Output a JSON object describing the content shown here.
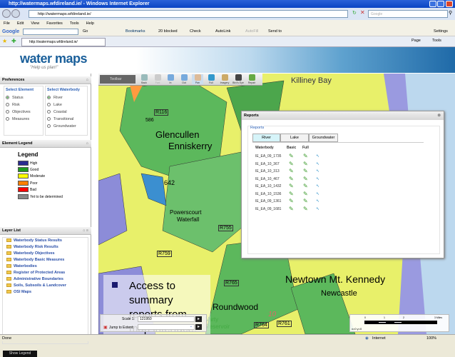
{
  "window": {
    "title": "http://watermaps.wfdireland.ie/ - Windows Internet Explorer",
    "url": "http://watermaps.wfdireland.ie/",
    "search_placeholder": "Google"
  },
  "menu": [
    "File",
    "Edit",
    "View",
    "Favorites",
    "Tools",
    "Help"
  ],
  "google_toolbar": {
    "brand": "Google",
    "go": "Go",
    "bookmarks": "Bookmarks",
    "blocked": "20 blocked",
    "check": "Check",
    "autolink": "AutoLink",
    "autofill": "AutoFill",
    "sendto": "Send to",
    "settings": "Settings"
  },
  "tab": {
    "label": "http://watermaps.wfdireland.ie/",
    "page": "Page",
    "tools": "Tools"
  },
  "site": {
    "logo": "water maps",
    "tagline": "\"Help us plan!\""
  },
  "preferences": {
    "title": "Preferences",
    "select_element": "Select Element",
    "elements": [
      "Status",
      "Risk",
      "Objectives",
      "Measures"
    ],
    "select_waterbody": "Select Waterbody",
    "waterbodies": [
      "River",
      "Lake",
      "Coastal",
      "Transitional",
      "Groundwater"
    ]
  },
  "legend": {
    "panel_title": "Element Legend",
    "title": "Legend",
    "items": [
      {
        "label": "High",
        "color": "#2b2b8f"
      },
      {
        "label": "Good",
        "color": "#1f9a1f"
      },
      {
        "label": "Moderate",
        "color": "#ffff00"
      },
      {
        "label": "Poor",
        "color": "#ff7f00"
      },
      {
        "label": "Bad",
        "color": "#ff0000"
      },
      {
        "label": "Yet to be determined",
        "color": "#888888"
      }
    ]
  },
  "layers": {
    "title": "Layer List",
    "items": [
      "Waterbody Status Results",
      "Waterbody Risk Results",
      "Waterbody Objectives",
      "Waterbody Basic Measures",
      "Waterbodies",
      "Register of Protected Areas",
      "Administrative Boundaries",
      "Soils, Subsoils & Landcover",
      "OSI Maps"
    ],
    "show_legend": "Show Legend"
  },
  "map_toolbar": {
    "title": "Toolbar",
    "tools": [
      "Back",
      "Fwd",
      "In",
      "Out",
      "Pan",
      "Full",
      "Imagery",
      "Bird's Eye",
      "Repair"
    ]
  },
  "map_labels": {
    "killiney": "Killiney Bay",
    "r116": "R116",
    "n586": "586",
    "glencullen": "Glencullen",
    "enniskerry": "Enniskerry",
    "n642": "642",
    "powerscourt": "Powerscourt",
    "waterfall": "Waterfall",
    "r755": "R755",
    "r759": "R759",
    "r765": "R765",
    "newtown": "Newtown Mt. Kennedy",
    "newcastle": "Newcastle",
    "roundwood": "Roundwood",
    "r764": "R764",
    "r761": "R761",
    "n10": "10",
    "varty": "Varty",
    "reservoir": "Reservoir"
  },
  "callout": {
    "text": "Access to summary reports from map interface."
  },
  "reports": {
    "title": "Reports",
    "group": "Reports",
    "tabs": [
      "River",
      "Lake",
      "Groundwater"
    ],
    "columns": [
      "Waterbody",
      "Basic",
      "Full"
    ],
    "rows": [
      "IE_EA_09_1735",
      "IE_EA_10_367",
      "IE_EA_10_313",
      "IE_EA_10_467",
      "IE_EA_10_1432",
      "IE_EA_10_1536",
      "IE_EA_09_1361",
      "IE_EA_09_1681"
    ]
  },
  "scale": {
    "label": "Scale 1:",
    "value": "121950",
    "jump_label": "Jump to Extent:",
    "ticks": [
      "0",
      "1",
      "2",
      "3 Miles"
    ],
    "coords": "x=0 y=0"
  },
  "status": {
    "left": "Done",
    "zone": "Internet",
    "zoom": "100%"
  }
}
